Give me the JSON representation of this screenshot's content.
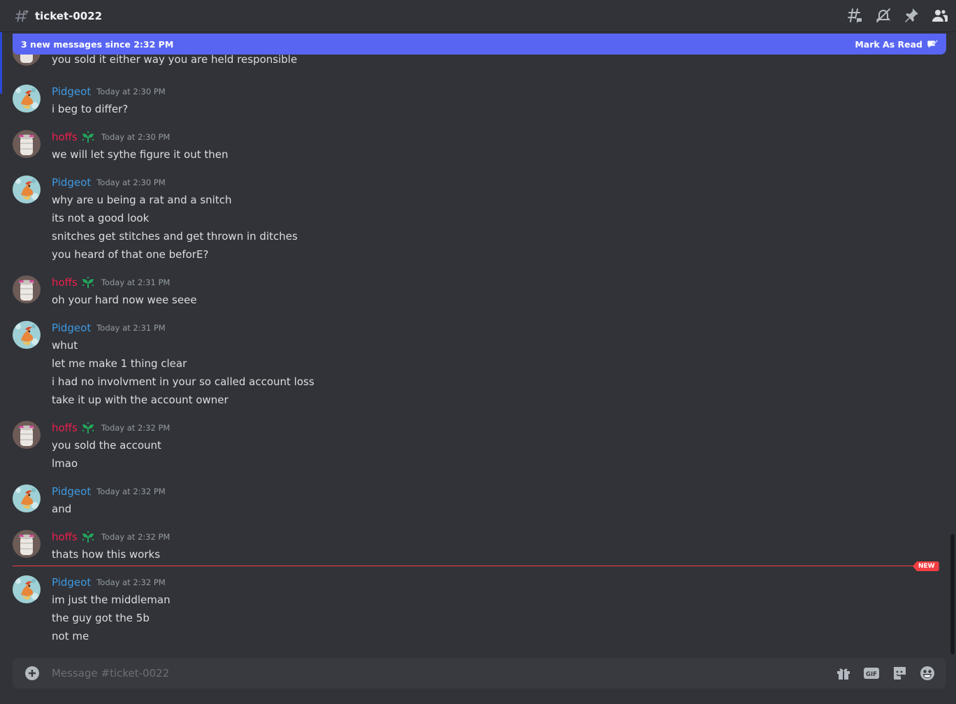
{
  "channel": {
    "name": "ticket-0022"
  },
  "banner": {
    "text": "3 new messages since 2:32 PM",
    "mark_read": "Mark As Read"
  },
  "partial_message": "you sold it either way you are held responsible",
  "users": {
    "pidgeot": {
      "name": "Pidgeot",
      "color": "#3e9ae3"
    },
    "hoffs": {
      "name": "hoffs",
      "color": "#ed1f4d"
    }
  },
  "messages": [
    {
      "user": "Pidgeot",
      "time": "Today at 2:30 PM",
      "lines": [
        "i beg  to differ?"
      ]
    },
    {
      "user": "hoffs",
      "time": "Today at 2:30 PM",
      "lines": [
        "we will let sythe figure it out then"
      ]
    },
    {
      "user": "Pidgeot",
      "time": "Today at 2:30 PM",
      "lines": [
        "why are u being a rat and a snitch",
        "its not a good look",
        "snitches get stitches and get thrown in ditches",
        "you heard of that one beforE?"
      ]
    },
    {
      "user": "hoffs",
      "time": "Today at 2:31 PM",
      "lines": [
        "oh your hard now wee seee"
      ]
    },
    {
      "user": "Pidgeot",
      "time": "Today at 2:31 PM",
      "lines": [
        "whut",
        "let me make 1 thing clear",
        "i had no involvment in your so called account loss",
        "take it up with the account owner"
      ]
    },
    {
      "user": "hoffs",
      "time": "Today at 2:32 PM",
      "lines": [
        "you sold the account",
        "lmao"
      ]
    },
    {
      "user": "Pidgeot",
      "time": "Today at 2:32 PM",
      "lines": [
        "and"
      ]
    },
    {
      "user": "hoffs",
      "time": "Today at 2:32 PM",
      "lines": [
        "thats how this works"
      ]
    },
    {
      "user": "Pidgeot",
      "time": "Today at 2:32 PM",
      "lines": [
        "im just the middleman",
        "the guy got the 5b",
        "not me"
      ]
    }
  ],
  "new_divider": "NEW",
  "composer": {
    "placeholder": "Message #ticket-0022"
  },
  "header_icons": [
    "threads-icon",
    "notification-muted-icon",
    "pin-icon",
    "member-list-icon"
  ],
  "composer_icons": [
    "add-attachment-icon",
    "gift-icon",
    "gif-icon",
    "sticker-icon",
    "emoji-icon"
  ]
}
